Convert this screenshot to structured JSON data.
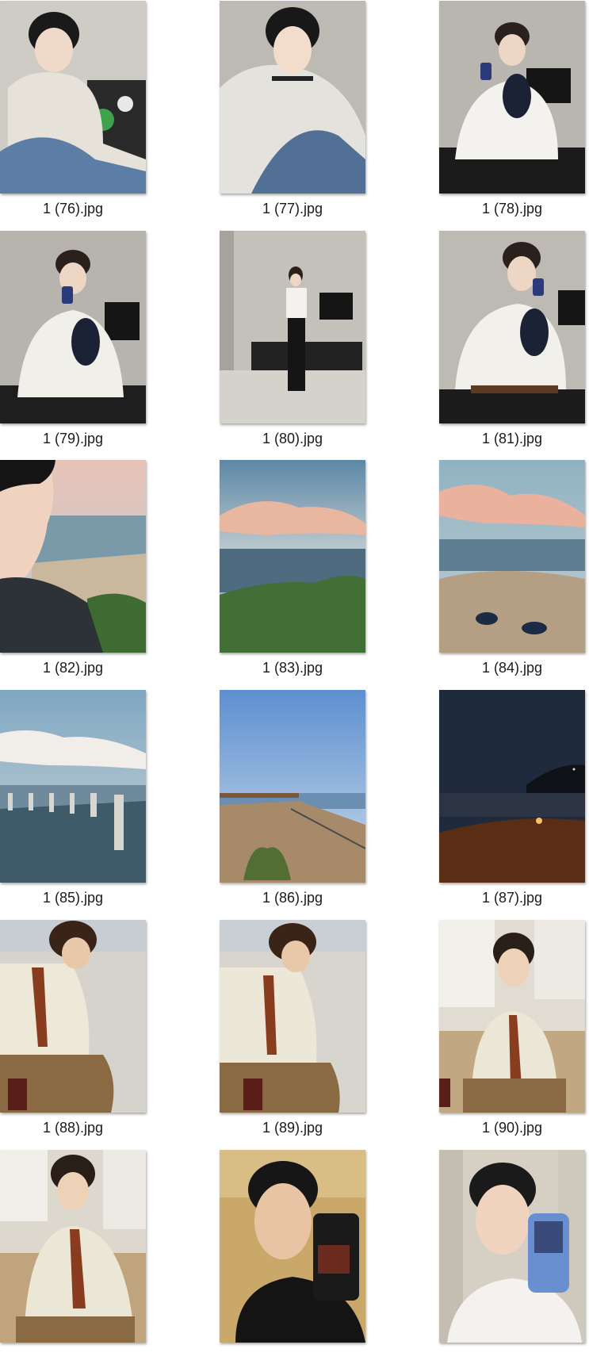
{
  "files": [
    {
      "name": "1 (76).jpg",
      "icon": "image-thumbnail"
    },
    {
      "name": "1 (77).jpg",
      "icon": "image-thumbnail"
    },
    {
      "name": "1 (78).jpg",
      "icon": "image-thumbnail"
    },
    {
      "name": "1 (79).jpg",
      "icon": "image-thumbnail"
    },
    {
      "name": "1 (80).jpg",
      "icon": "image-thumbnail"
    },
    {
      "name": "1 (81).jpg",
      "icon": "image-thumbnail"
    },
    {
      "name": "1 (82).jpg",
      "icon": "image-thumbnail"
    },
    {
      "name": "1 (83).jpg",
      "icon": "image-thumbnail"
    },
    {
      "name": "1 (84).jpg",
      "icon": "image-thumbnail"
    },
    {
      "name": "1 (85).jpg",
      "icon": "image-thumbnail"
    },
    {
      "name": "1 (86).jpg",
      "icon": "image-thumbnail"
    },
    {
      "name": "1 (87).jpg",
      "icon": "image-thumbnail"
    },
    {
      "name": "1 (88).jpg",
      "icon": "image-thumbnail"
    },
    {
      "name": "1 (89).jpg",
      "icon": "image-thumbnail"
    },
    {
      "name": "1 (90).jpg",
      "icon": "image-thumbnail"
    },
    {
      "name": "",
      "icon": "image-thumbnail"
    },
    {
      "name": "",
      "icon": "image-thumbnail"
    },
    {
      "name": "",
      "icon": "image-thumbnail"
    }
  ]
}
